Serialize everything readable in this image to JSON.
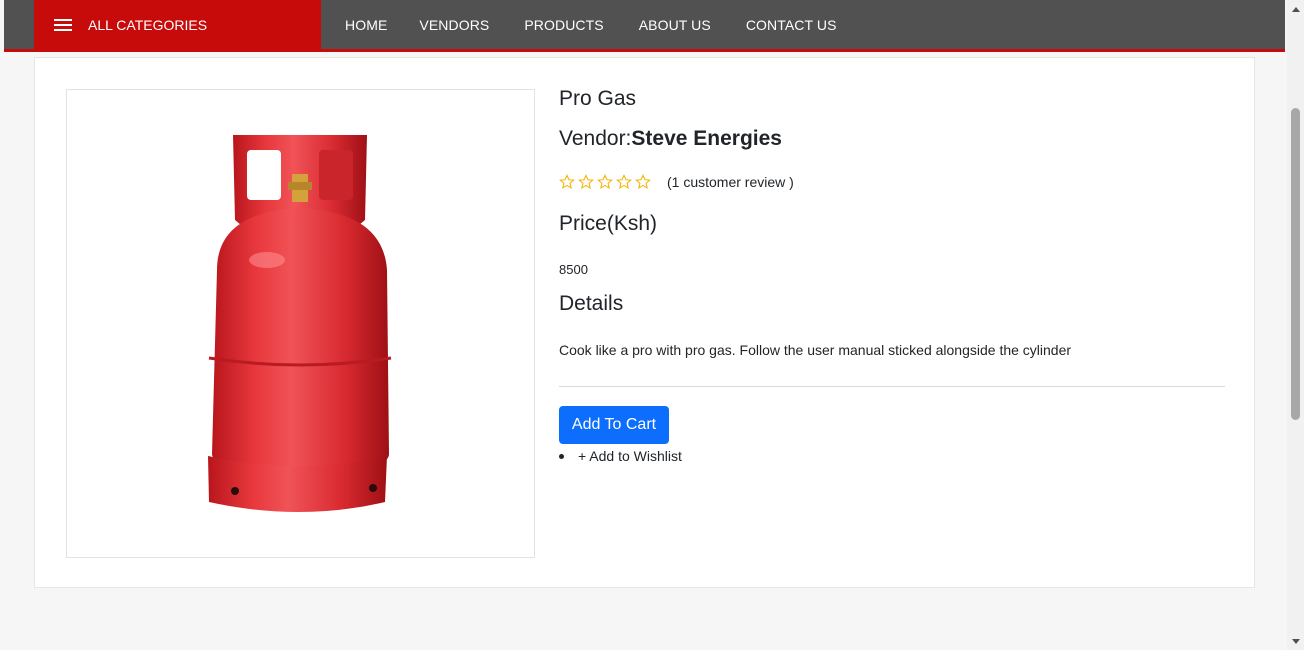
{
  "nav": {
    "categories_label": "ALL CATEGORIES",
    "links": [
      "HOME",
      "VENDORS",
      "PRODUCTS",
      "ABOUT US",
      "CONTACT US"
    ]
  },
  "product": {
    "title": "Pro Gas",
    "vendor_prefix": "Vendor:",
    "vendor_name": "Steve Energies",
    "rating": {
      "stars": 0,
      "max": 5,
      "review_text": "(1 customer review )"
    },
    "price_heading": "Price(Ksh)",
    "price": "8500",
    "details_heading": "Details",
    "description": "Cook like a pro with pro gas. Follow the user manual sticked alongside the cylinder",
    "add_to_cart": "Add To Cart",
    "wishlist": "+ Add to Wishlist"
  },
  "colors": {
    "nav_bg": "#515151",
    "accent_red": "#c70a0a",
    "button_blue": "#0d6efd",
    "star": "#f5b301"
  }
}
